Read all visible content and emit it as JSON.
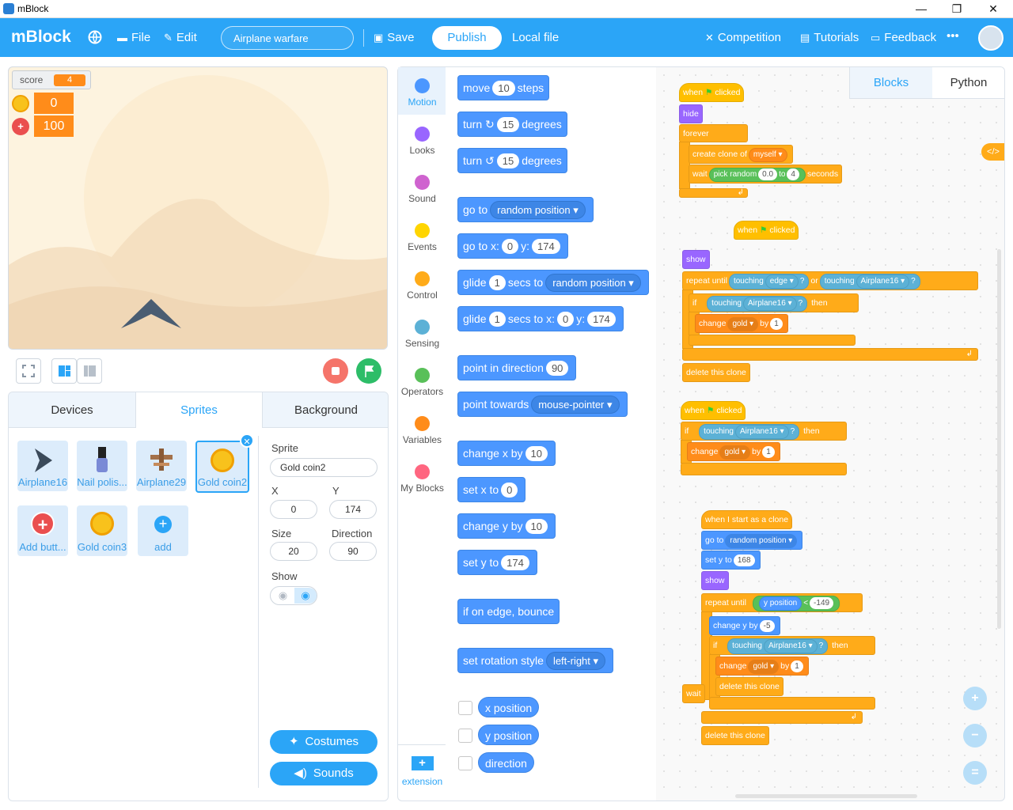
{
  "window": {
    "title": "mBlock",
    "minimize": "—",
    "restore": "❐",
    "close": "✕"
  },
  "menubar": {
    "logo": "mBlock",
    "file": "File",
    "edit": "Edit",
    "project_name": "Airplane warfare",
    "save": "Save",
    "publish": "Publish",
    "local_file": "Local file",
    "competition": "Competition",
    "tutorials": "Tutorials",
    "feedback": "Feedback",
    "more": "•••"
  },
  "stage": {
    "score_label": "score",
    "score_value": "4",
    "gold_value": "0",
    "health_value": "100"
  },
  "left_tabs": {
    "devices": "Devices",
    "sprites": "Sprites",
    "background": "Background"
  },
  "sprites": [
    {
      "name": "Airplane16"
    },
    {
      "name": "Nail polis..."
    },
    {
      "name": "Airplane29"
    },
    {
      "name": "Gold coin2"
    },
    {
      "name": "Add butt..."
    },
    {
      "name": "Gold coin3"
    },
    {
      "name": "add"
    }
  ],
  "sprite_props": {
    "sprite_label": "Sprite",
    "sprite_name": "Gold coin2",
    "x_label": "X",
    "x_value": "0",
    "y_label": "Y",
    "y_value": "174",
    "size_label": "Size",
    "size_value": "20",
    "direction_label": "Direction",
    "direction_value": "90",
    "show_label": "Show"
  },
  "buttons": {
    "costumes": "Costumes",
    "sounds": "Sounds"
  },
  "categories": [
    {
      "label": "Motion",
      "color": "#4c97ff"
    },
    {
      "label": "Looks",
      "color": "#9966ff"
    },
    {
      "label": "Sound",
      "color": "#cf63cf"
    },
    {
      "label": "Events",
      "color": "#ffd500"
    },
    {
      "label": "Control",
      "color": "#ffab19"
    },
    {
      "label": "Sensing",
      "color": "#5cb1d6"
    },
    {
      "label": "Operators",
      "color": "#59c059"
    },
    {
      "label": "Variables",
      "color": "#ff8c1a"
    },
    {
      "label": "My Blocks",
      "color": "#ff6680"
    }
  ],
  "extension_label": "extension",
  "palette": {
    "move_a": "move",
    "move_n": "10",
    "move_b": "steps",
    "turn_cw_a": "turn",
    "turn_cw_n": "15",
    "turn_cw_b": "degrees",
    "turn_ccw_a": "turn",
    "turn_ccw_n": "15",
    "turn_ccw_b": "degrees",
    "goto_a": "go to",
    "goto_dd": "random position ▾",
    "gotoxy_a": "go to x:",
    "gotoxy_x": "0",
    "gotoxy_b": "y:",
    "gotoxy_y": "174",
    "glide_a": "glide",
    "glide_n": "1",
    "glide_b": "secs to",
    "glide_dd": "random position ▾",
    "glidexy_a": "glide",
    "glidexy_n": "1",
    "glidexy_b": "secs to x:",
    "glidexy_x": "0",
    "glidexy_c": "y:",
    "glidexy_y": "174",
    "dir_a": "point in direction",
    "dir_n": "90",
    "towards_a": "point towards",
    "towards_dd": "mouse-pointer ▾",
    "chx_a": "change x by",
    "chx_n": "10",
    "setx_a": "set x to",
    "setx_n": "0",
    "chy_a": "change y by",
    "chy_n": "10",
    "sety_a": "set y to",
    "sety_n": "174",
    "edge": "if on edge, bounce",
    "rot_a": "set rotation style",
    "rot_dd": "left-right ▾",
    "xpos": "x position",
    "ypos": "y position",
    "direction": "direction"
  },
  "code_tabs": {
    "blocks": "Blocks",
    "python": "Python"
  },
  "script": {
    "when": "when",
    "clicked": "clicked",
    "hide": "hide",
    "forever": "forever",
    "create_clone": "create clone of",
    "myself": "myself ▾",
    "wait": "wait",
    "pick_random": "pick random",
    "r_from": "0.0",
    "r_to_word": "to",
    "r_to": "4",
    "seconds": "seconds",
    "show": "show",
    "repeat_until": "repeat until",
    "touching": "touching",
    "edge": "edge ▾",
    "q": "?",
    "or": "or",
    "airplane": "Airplane16 ▾",
    "if": "if",
    "then": "then",
    "change": "change",
    "gold": "gold ▾",
    "by": "by",
    "one": "1",
    "delete_clone": "delete this clone",
    "start_clone": "when I start as a clone",
    "goto": "go to",
    "random_pos": "random position ▾",
    "sety": "set y to",
    "sety_n": "168",
    "ypos": "y position",
    "lt": "<",
    "neg149": "-149",
    "chy": "change y by",
    "neg5": "-5",
    "arrow": "↲",
    "code_toggle": "</>"
  },
  "zoom": {
    "in": "+",
    "out": "−",
    "reset": "="
  }
}
